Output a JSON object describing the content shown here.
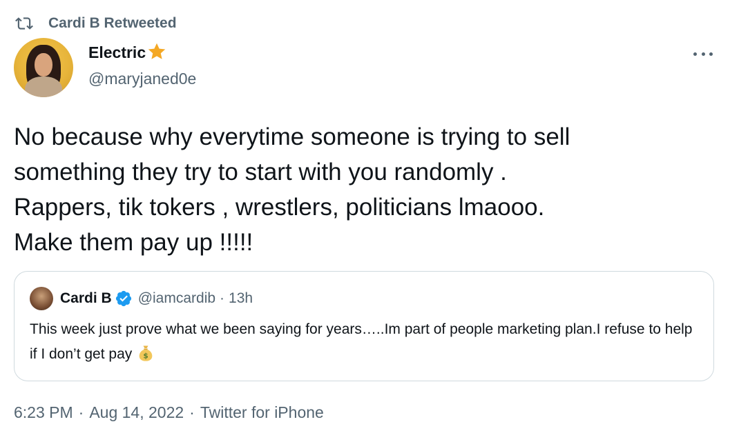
{
  "retweet": {
    "label": "Cardi B Retweeted",
    "icon": "retweet-icon"
  },
  "author": {
    "name": "Electric",
    "badge_icon": "star-icon",
    "handle": "@maryjaned0e"
  },
  "tweet": {
    "text": "No because why everytime someone  is trying to sell\nsomething they try to start with you randomly .\nRappers, tik tokers , wrestlers, politicians lmaooo.\nMake them pay up !!!!!"
  },
  "quote": {
    "name": "Cardi B",
    "verified_icon": "verified-icon",
    "handle": "@iamcardib",
    "separator": "·",
    "time": "13h",
    "text": "This week just prove what we been saying for years…..Im part of people marketing plan.I refuse to help if I don’t get pay",
    "emoji": "money-bag-icon"
  },
  "meta": {
    "time": "6:23 PM",
    "dot": "·",
    "date": "Aug 14, 2022",
    "source": "Twitter for iPhone"
  },
  "colors": {
    "text_primary": "#0f1419",
    "text_secondary": "#536471",
    "border": "#cfd9de",
    "verified_blue": "#1d9bf0",
    "star_orange": "#f4a825"
  }
}
